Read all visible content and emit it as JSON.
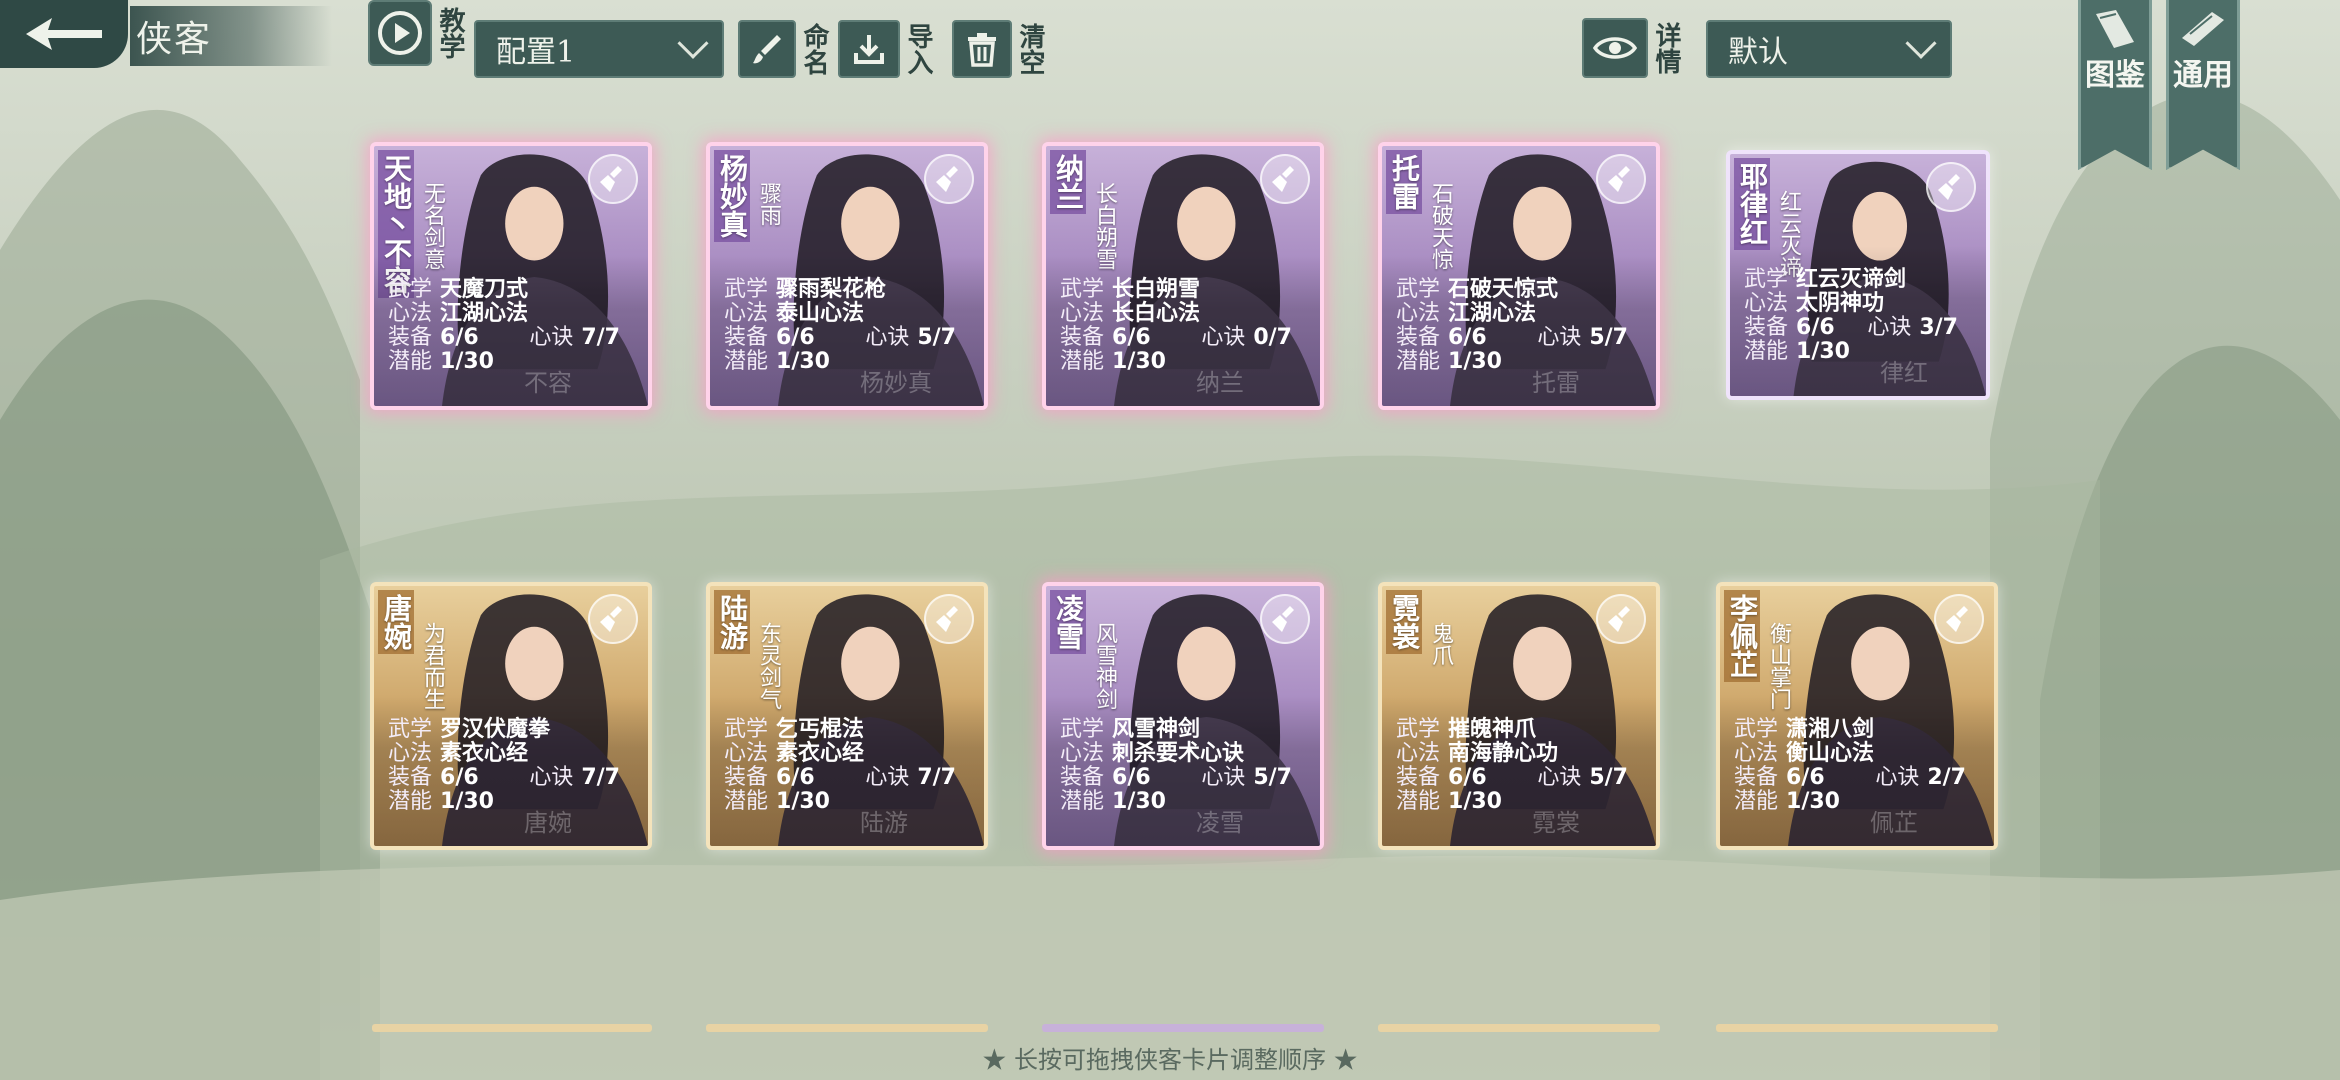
{
  "header": {
    "title": "侠客",
    "tutorial_label": "教学",
    "config_value": "配置1",
    "rename_label": "命名",
    "import_label": "导入",
    "clear_label": "清空",
    "detail_label": "详情",
    "sort_value": "默认"
  },
  "banners": [
    {
      "label": "图鉴"
    },
    {
      "label": "通用"
    }
  ],
  "labels": {
    "martial": "武学",
    "mind": "心法",
    "equip": "装备",
    "secret": "心诀",
    "potential": "潜能"
  },
  "cards": [
    {
      "name": "天地丶不容",
      "title": "无名剑意",
      "martial": "天魔刀式",
      "mind": "江湖心法",
      "equip": "6/6",
      "secret": "7/7",
      "potential": "1/30",
      "faint": "不容",
      "style": "purple",
      "selected": true
    },
    {
      "name": "杨妙真",
      "title": "骤雨",
      "martial": "骤雨梨花枪",
      "mind": "泰山心法",
      "equip": "6/6",
      "secret": "5/7",
      "potential": "1/30",
      "faint": "杨妙真",
      "style": "purple",
      "selected": true
    },
    {
      "name": "纳兰",
      "title": "长白朔雪",
      "martial": "长白朔雪",
      "mind": "长白心法",
      "equip": "6/6",
      "secret": "0/7",
      "potential": "1/30",
      "faint": "纳兰",
      "style": "purple",
      "selected": true
    },
    {
      "name": "托雷",
      "title": "石破天惊",
      "martial": "石破天惊式",
      "mind": "江湖心法",
      "equip": "6/6",
      "secret": "5/7",
      "potential": "1/30",
      "faint": "托雷",
      "style": "purple",
      "selected": true
    },
    {
      "name": "耶律红",
      "title": "红云灭谛",
      "martial": "红云灭谛剑",
      "mind": "太阴神功",
      "equip": "6/6",
      "secret": "3/7",
      "potential": "1/30",
      "faint": "律红",
      "style": "purple",
      "selected": false
    },
    {
      "name": "唐婉",
      "title": "为君而生",
      "martial": "罗汉伏魔拳",
      "mind": "素衣心经",
      "equip": "6/6",
      "secret": "7/7",
      "potential": "1/30",
      "faint": "唐婉",
      "style": "gold",
      "selected": false
    },
    {
      "name": "陆游",
      "title": "东灵剑气",
      "martial": "乞丐棍法",
      "mind": "素衣心经",
      "equip": "6/6",
      "secret": "7/7",
      "potential": "1/30",
      "faint": "陆游",
      "style": "gold",
      "selected": false
    },
    {
      "name": "凌雪",
      "title": "风雪神剑",
      "martial": "风雪神剑",
      "mind": "刺杀要术心诀",
      "equip": "6/6",
      "secret": "5/7",
      "potential": "1/30",
      "faint": "凌雪",
      "style": "purple",
      "selected": true
    },
    {
      "name": "霓裳",
      "title": "鬼爪",
      "martial": "摧魄神爪",
      "mind": "南海静心功",
      "equip": "6/6",
      "secret": "5/7",
      "potential": "1/30",
      "faint": "霓裳",
      "style": "gold",
      "selected": false
    },
    {
      "name": "李佩芷",
      "title": "衡山掌门",
      "martial": "潇湘八剑",
      "mind": "衡山心法",
      "equip": "6/6",
      "secret": "2/7",
      "potential": "1/30",
      "faint": "佩芷",
      "style": "gold",
      "selected": false
    }
  ],
  "footer": {
    "hint": "★ 长按可拖拽侠客卡片调整顺序 ★"
  },
  "colors": {
    "panel": "#3d5a55",
    "purple_card": "#a98dc2",
    "gold_card": "#cfa86c"
  }
}
